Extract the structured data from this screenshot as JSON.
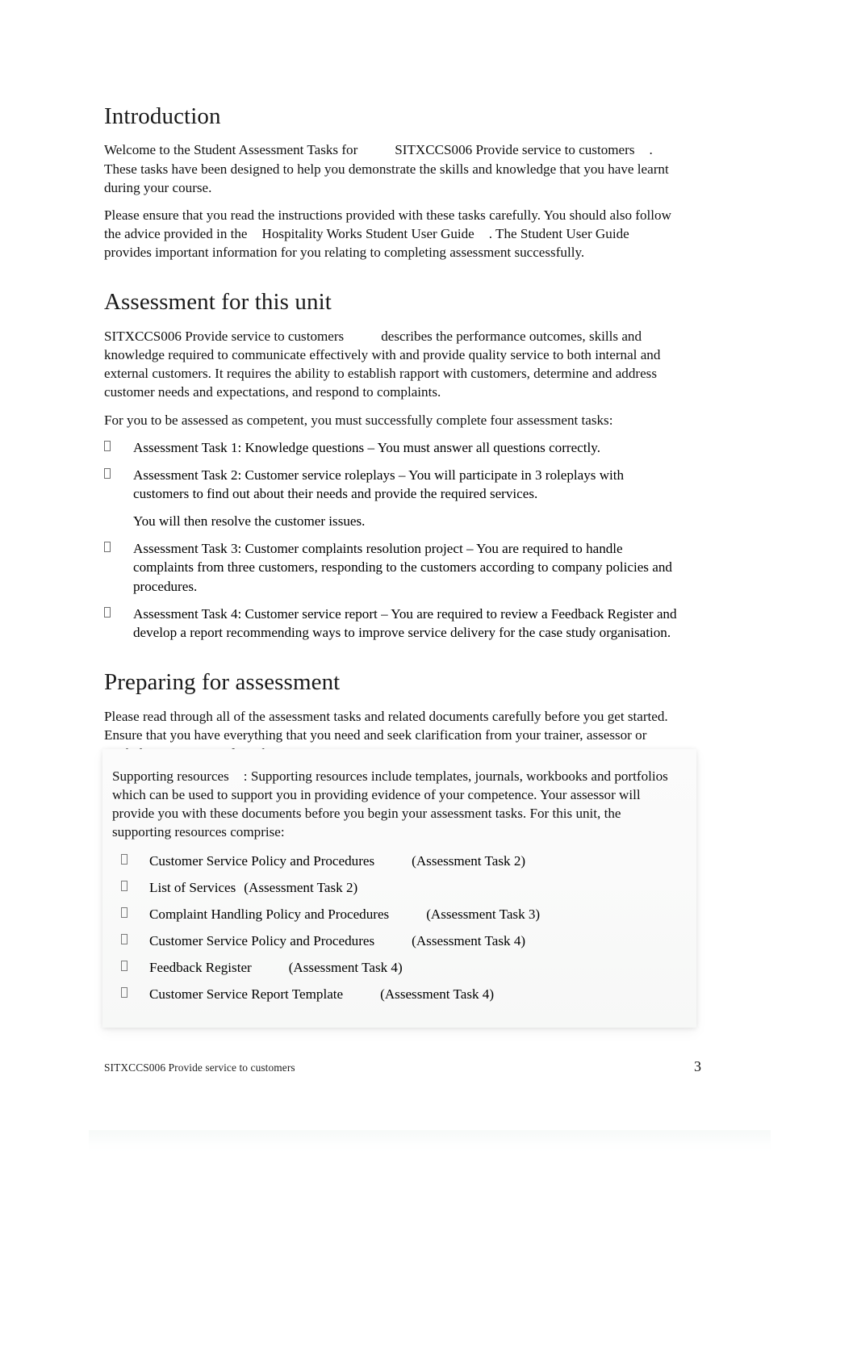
{
  "document": {
    "sections": [
      {
        "heading": "Introduction",
        "paragraphs": [
          {
            "parts": [
              "Welcome to the Student Assessment Tasks for",
              "SITXCCS006 Provide service to customers",
              ". These tasks have been designed to help you demonstrate the skills and knowledge that you have learnt during your course."
            ]
          },
          {
            "parts": [
              "Please ensure that you read the instructions provided with these tasks carefully. You should also follow the advice provided in the",
              "Hospitality Works Student User Guide",
              ". The Student User Guide provides important information for you relating to completing assessment successfully."
            ]
          }
        ]
      },
      {
        "heading": "Assessment for this unit",
        "intro_unit_code": "SITXCCS006 Provide service to customers",
        "intro_rest": "describes the performance outcomes, skills and knowledge required to communicate effectively with and provide quality service to both internal and external customers. It requires the ability to establish rapport with customers, determine and address customer needs and expectations, and respond to complaints.",
        "lead_in": "For you to be assessed as competent, you must successfully complete four assessment tasks:",
        "tasks": [
          {
            "text": "Assessment Task 1: Knowledge questions – You must answer all questions correctly."
          },
          {
            "text": "Assessment Task 2: Customer service roleplays – You will participate in 3 roleplays with customers to find out about their needs and provide the required services.",
            "note": "You will then resolve the customer issues."
          },
          {
            "text": "Assessment Task 3: Customer complaints resolution project – You are required to handle complaints from three customers, responding to the customers according to company policies and procedures."
          },
          {
            "text": "Assessment Task 4: Customer service report – You are required to review a Feedback Register and develop a report recommending ways to improve service delivery for the case study organisation."
          }
        ]
      },
      {
        "heading": "Preparing for assessment",
        "paragraph": "Please read through all of the assessment tasks and related documents carefully before you get started. Ensure that you have everything that you need and seek clarification from your trainer, assessor or workplace supervisor if you have any questions."
      }
    ]
  },
  "callout": {
    "label": "Supporting resources",
    "body": ": Supporting resources include templates, journals, workbooks and portfolios which can be used to support you in providing evidence of your competence. Your assessor will provide you with these documents before you begin your assessment tasks. For this unit, the supporting resources comprise:",
    "resources": [
      {
        "name": "Customer Service Policy and Procedures",
        "task": "(Assessment Task 2)"
      },
      {
        "name": "List of Services",
        "task": "(Assessment Task 2)"
      },
      {
        "name": "Complaint Handling Policy and Procedures",
        "task": "(Assessment Task 3)"
      },
      {
        "name": "Customer Service Policy and Procedures",
        "task": "(Assessment Task 4)"
      },
      {
        "name": "Feedback Register",
        "task": "(Assessment Task 4)"
      },
      {
        "name": "Customer Service Report Template",
        "task": "(Assessment Task 4)"
      }
    ]
  },
  "footer": {
    "text": "SITXCCS006 Provide service to customers",
    "page_number": "3"
  },
  "colors": {
    "text": "#111111",
    "bullet_outline": "#6f6f6f",
    "callout_background": "#fafafa",
    "page_background": "#ffffff"
  }
}
